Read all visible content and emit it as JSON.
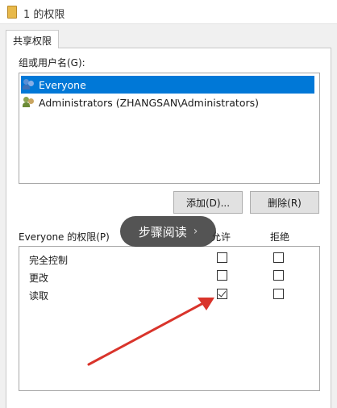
{
  "window": {
    "title": "1 的权限"
  },
  "tabs": [
    {
      "label": "共享权限"
    }
  ],
  "users": {
    "label": "组或用户名(G):",
    "items": [
      {
        "name": "Everyone",
        "selected": true
      },
      {
        "name": "Administrators (ZHANGSAN\\Administrators)",
        "selected": false
      }
    ]
  },
  "buttons": {
    "add": "添加(D)...",
    "remove": "删除(R)"
  },
  "permissions": {
    "label": "Everyone 的权限(P)",
    "allow_header": "允许",
    "deny_header": "拒绝",
    "rows": [
      {
        "name": "完全控制",
        "allow": false,
        "deny": false
      },
      {
        "name": "更改",
        "allow": false,
        "deny": false
      },
      {
        "name": "读取",
        "allow": true,
        "deny": false
      }
    ]
  },
  "overlay": {
    "label": "步骤阅读",
    "icon": "chevron-right-icon"
  },
  "colors": {
    "accent": "#0078d7",
    "annotation_arrow": "#d9342b"
  }
}
